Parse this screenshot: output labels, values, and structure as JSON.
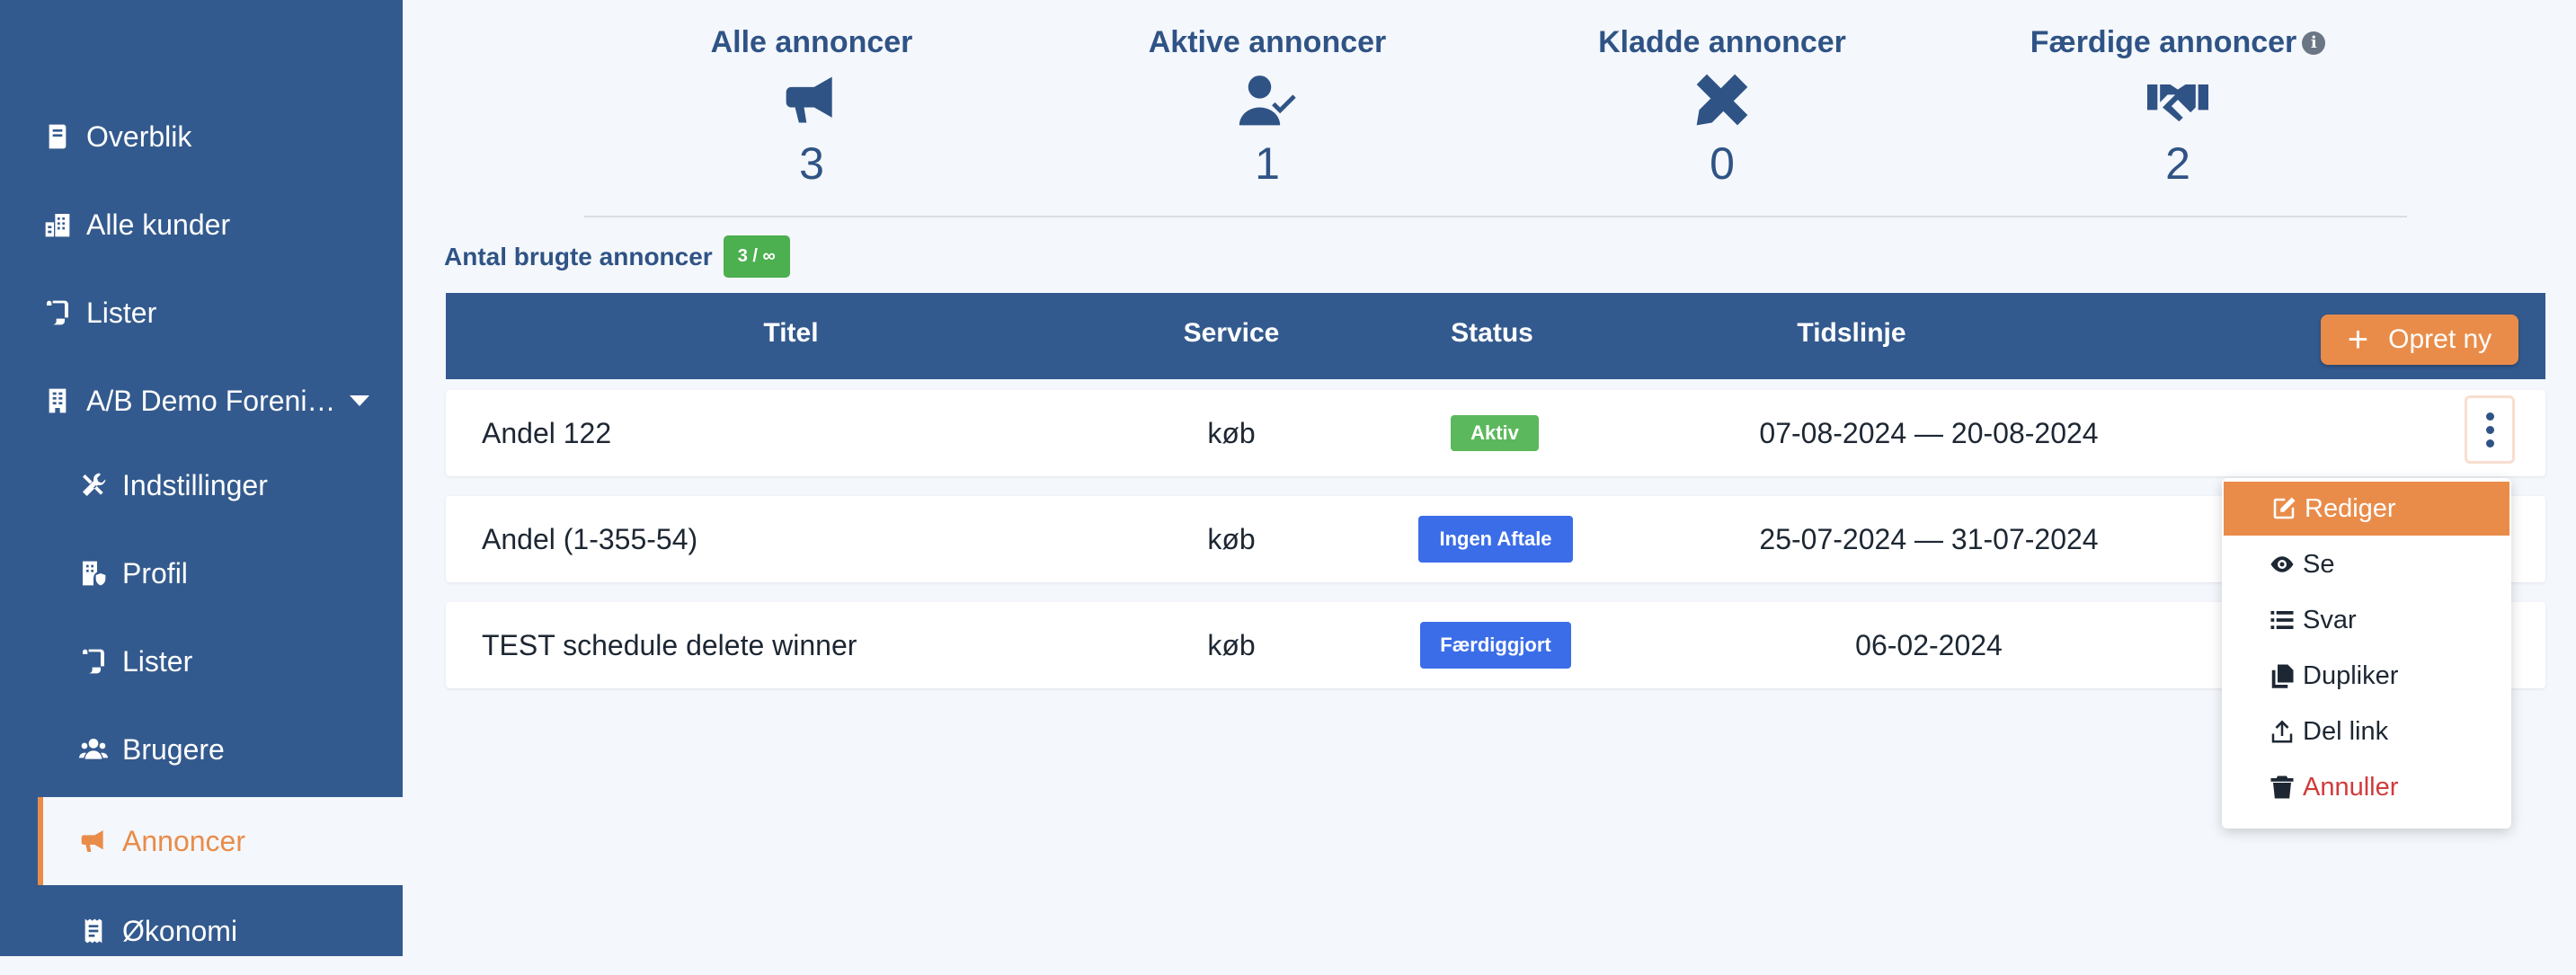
{
  "sidebar": {
    "items": [
      {
        "label": "Overblik",
        "icon": "book-icon"
      },
      {
        "label": "Alle kunder",
        "icon": "city-icon"
      },
      {
        "label": "Lister",
        "icon": "scroll-icon"
      },
      {
        "label": "A/B Demo Foreni…",
        "icon": "building-icon"
      },
      {
        "label": "Indstillinger",
        "icon": "tools-icon"
      },
      {
        "label": "Profil",
        "icon": "building-shield-icon"
      },
      {
        "label": "Lister",
        "icon": "scroll-icon"
      },
      {
        "label": "Brugere",
        "icon": "users-icon"
      },
      {
        "label": "Annoncer",
        "icon": "megaphone-icon"
      },
      {
        "label": "Økonomi",
        "icon": "receipt-icon"
      }
    ]
  },
  "stats": [
    {
      "label": "Alle annoncer",
      "value": "3",
      "icon": "megaphone-icon"
    },
    {
      "label": "Aktive annoncer",
      "value": "1",
      "icon": "user-check-icon"
    },
    {
      "label": "Kladde annoncer",
      "value": "0",
      "icon": "pencil-ruler-icon"
    },
    {
      "label": "Færdige annoncer",
      "value": "2",
      "icon": "handshake-icon",
      "info": "i"
    }
  ],
  "usage": {
    "label": "Antal brugte annoncer",
    "badge": "3 / ∞"
  },
  "table": {
    "headers": {
      "title": "Titel",
      "service": "Service",
      "status": "Status",
      "timeline": "Tidslinje"
    },
    "create_label": "Opret ny",
    "rows": [
      {
        "title": "Andel 122",
        "service": "køb",
        "status": "Aktiv",
        "status_color": "#5cb85c",
        "timeline": "07-08-2024 — 20-08-2024"
      },
      {
        "title": "Andel (1-355-54)",
        "service": "køb",
        "status": "Ingen Aftale",
        "status_color": "#3b6de8",
        "timeline": "25-07-2024 — 31-07-2024"
      },
      {
        "title": "TEST schedule delete winner",
        "service": "køb",
        "status": "Færdiggjort",
        "status_color": "#3b6de8",
        "timeline": "06-02-2024"
      }
    ]
  },
  "menu": {
    "items": [
      {
        "label": "Rediger",
        "icon": "edit-icon"
      },
      {
        "label": "Se",
        "icon": "eye-icon"
      },
      {
        "label": "Svar",
        "icon": "list-icon"
      },
      {
        "label": "Dupliker",
        "icon": "copy-icon"
      },
      {
        "label": "Del link",
        "icon": "share-icon"
      },
      {
        "label": "Annuller",
        "icon": "trash-icon"
      }
    ]
  },
  "colors": {
    "sidebar": "#335a8e",
    "accent": "#e98c4a",
    "primary_text": "#2f5385",
    "success": "#4caf50",
    "info": "#3b6de8"
  }
}
